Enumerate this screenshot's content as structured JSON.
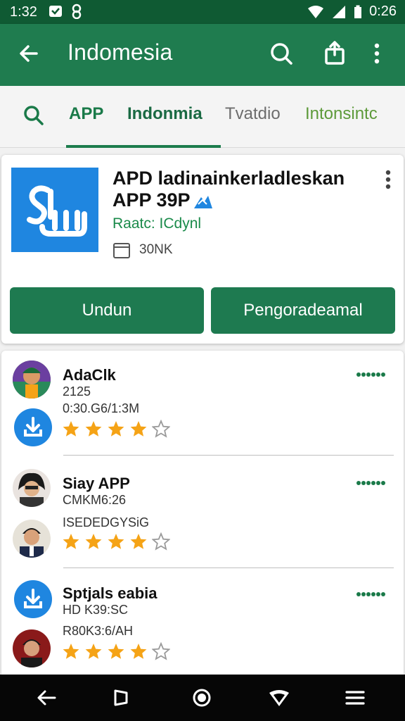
{
  "status_bar": {
    "time": "1:32",
    "clock_right": "0:26"
  },
  "app_bar": {
    "title": "Indomesia",
    "icons": [
      "back-arrow-icon",
      "search-icon",
      "share-icon",
      "more-vert-icon"
    ]
  },
  "tabs": [
    {
      "label": "APP"
    },
    {
      "label": "Indonmia"
    },
    {
      "label": "Tvatdio"
    },
    {
      "label": "Intonsintc"
    }
  ],
  "app_card": {
    "name": "APD ladinainkerladleskan APP 39P",
    "rating": "Raatc: ICdynl",
    "size": "30NK",
    "primary_button": "Undun",
    "secondary_button": "Pengoradeamal"
  },
  "list": {
    "items": [
      {
        "title": "AdaClk",
        "line1": "2125",
        "line2": "0:30.G6/1:3M",
        "stars": 4
      },
      {
        "title": "Siay APP",
        "line1": "CMKM6:26",
        "line2": "ISEDEDGYSiG",
        "stars": 4
      },
      {
        "title": "Sptjals eabia",
        "line1": "HD K39:SC",
        "line2": "R80K3:6/AH",
        "stars": 4
      }
    ]
  },
  "colors": {
    "brand_dark": "#0f5a33",
    "brand": "#1f7c4f",
    "button": "#1e7a50",
    "accent_blue": "#1f86e0",
    "star": "#f5a316"
  }
}
